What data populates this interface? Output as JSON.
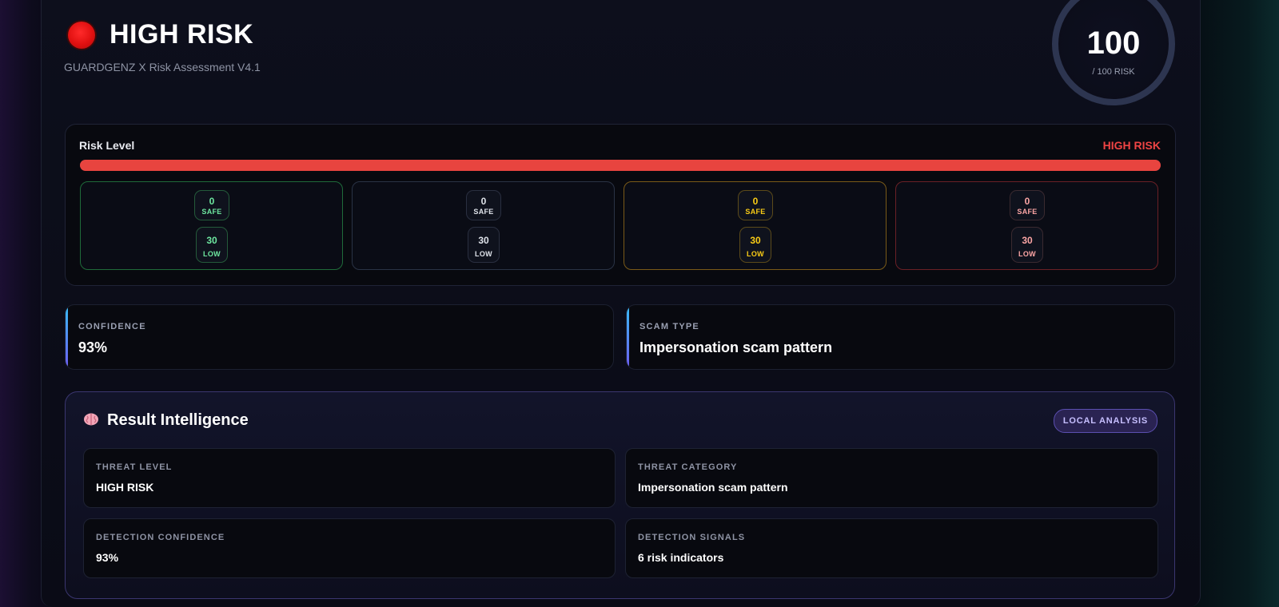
{
  "header": {
    "title": "HIGH RISK",
    "subtitle": "GUARDGENZ X Risk Assessment V4.1",
    "status_icon": "red-circle",
    "status_color": "#e01010"
  },
  "score": {
    "value": "100",
    "caption": "/ 100 RISK"
  },
  "risk_level": {
    "label": "Risk Level",
    "value": "HIGH RISK",
    "value_color": "#ef4444",
    "fill_percent": 100,
    "segments": [
      {
        "tone": "green",
        "top_value": "0",
        "top_label": "SAFE",
        "bottom_value": "30",
        "bottom_label": "LOW"
      },
      {
        "tone": "slate",
        "top_value": "0",
        "top_label": "SAFE",
        "bottom_value": "30",
        "bottom_label": "LOW"
      },
      {
        "tone": "amber",
        "top_value": "0",
        "top_label": "SAFE",
        "bottom_value": "30",
        "bottom_label": "LOW"
      },
      {
        "tone": "red",
        "top_value": "0",
        "top_label": "SAFE",
        "bottom_value": "30",
        "bottom_label": "LOW"
      }
    ]
  },
  "summary": {
    "confidence": {
      "label": "CONFIDENCE",
      "value": "93%"
    },
    "scam_type": {
      "label": "SCAM TYPE",
      "value": "Impersonation scam pattern"
    }
  },
  "intelligence": {
    "icon": "brain-icon",
    "title": "Result Intelligence",
    "badge": "LOCAL ANALYSIS",
    "cells": [
      {
        "label": "THREAT LEVEL",
        "value": "HIGH RISK"
      },
      {
        "label": "THREAT CATEGORY",
        "value": "Impersonation scam pattern"
      },
      {
        "label": "DETECTION CONFIDENCE",
        "value": "93%"
      },
      {
        "label": "DETECTION SIGNALS",
        "value": "6 risk indicators"
      }
    ]
  }
}
